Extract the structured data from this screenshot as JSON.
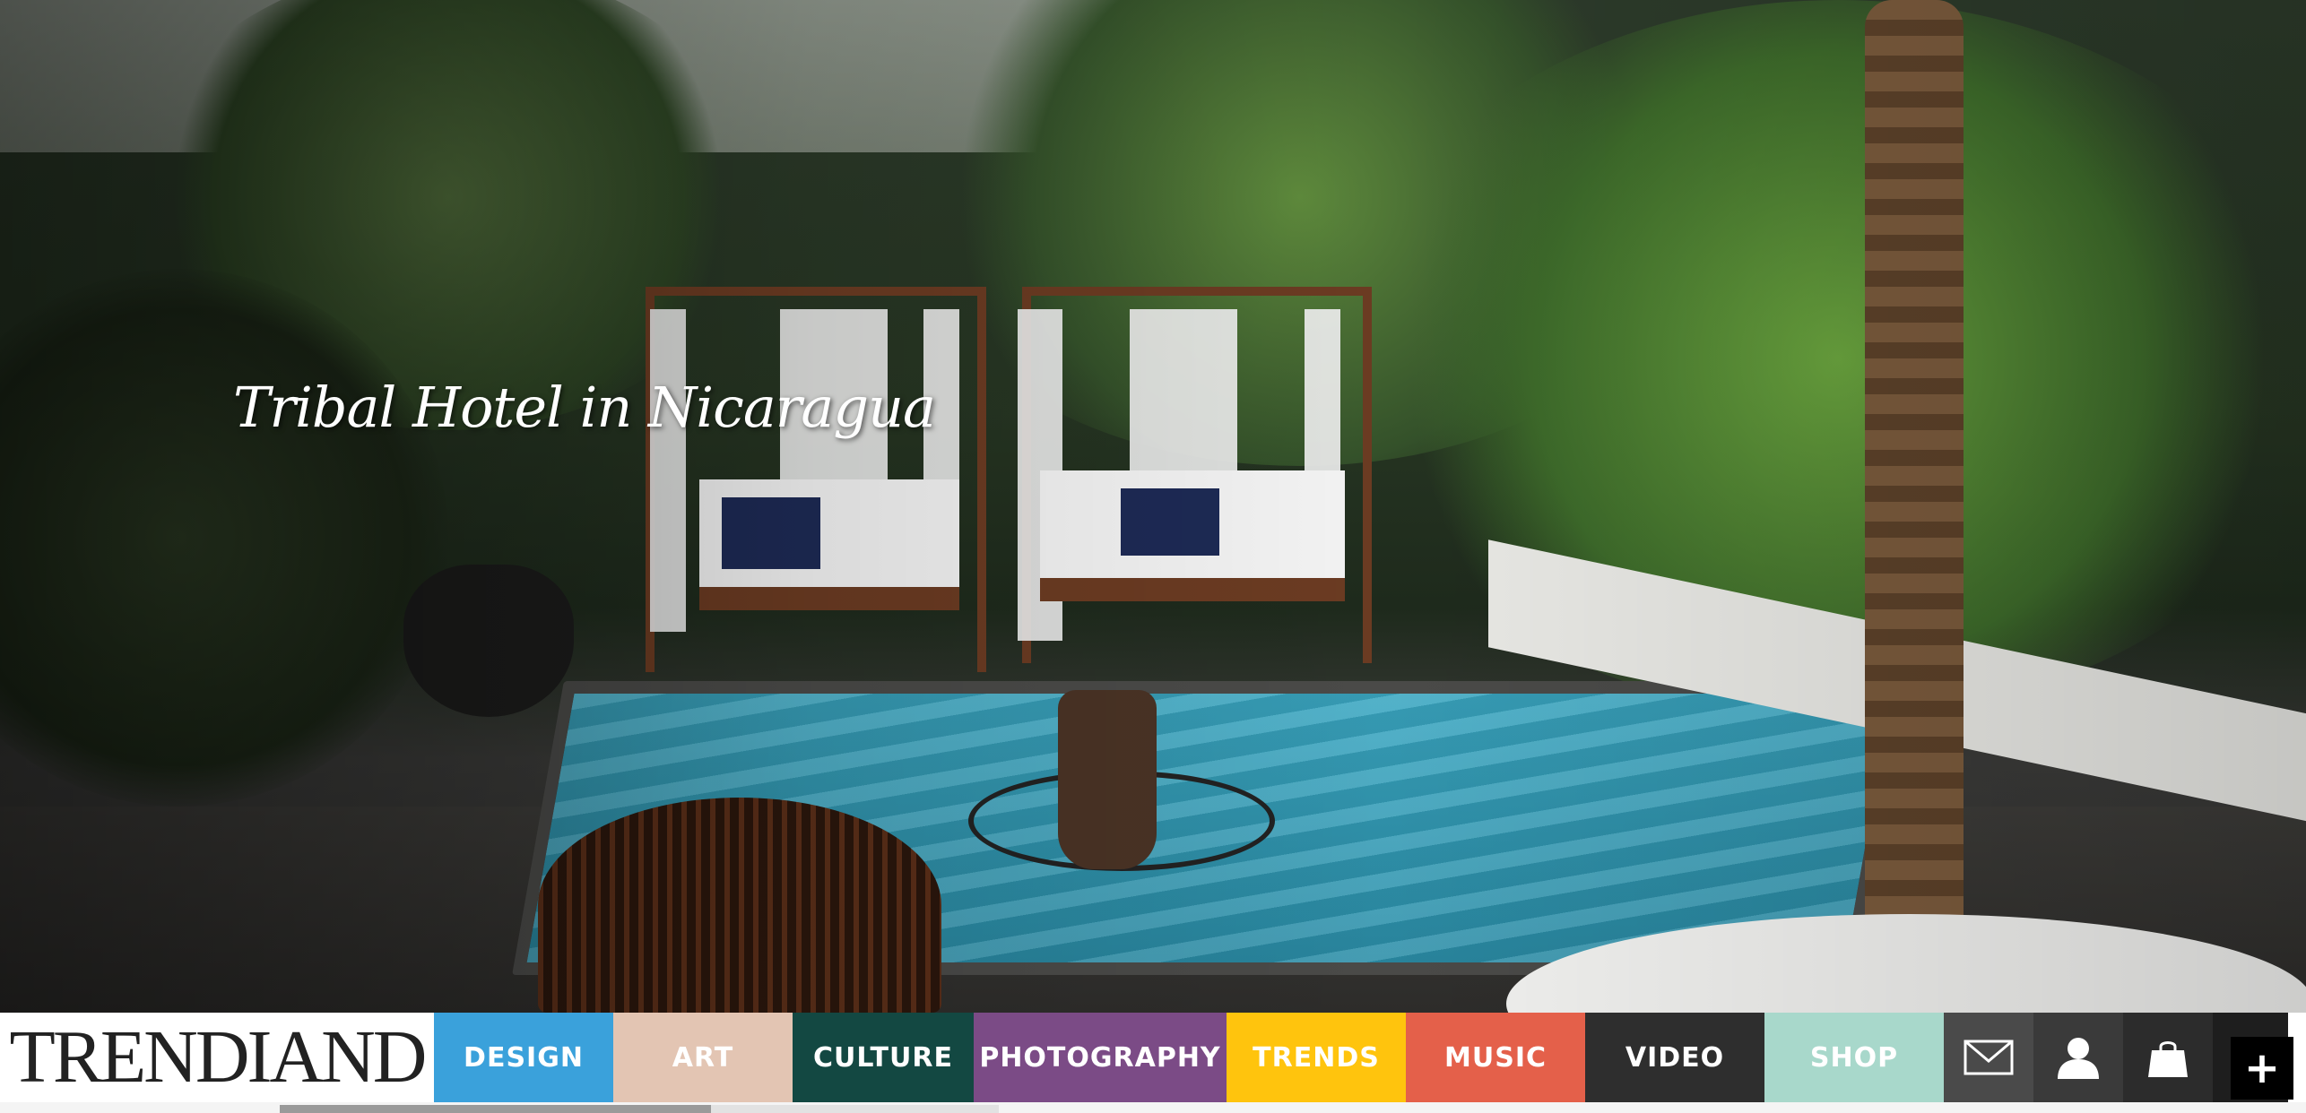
{
  "hero": {
    "title": "Tribal Hotel in Nicaragua"
  },
  "logo": {
    "text": "TRENDIAND"
  },
  "nav": {
    "items": [
      {
        "label": "DESIGN",
        "color": "#3aa1db"
      },
      {
        "label": "ART",
        "color": "#e3c5b3"
      },
      {
        "label": "CULTURE",
        "color": "#134842"
      },
      {
        "label": "PHOTOGRAPHY",
        "color": "#7b4b86"
      },
      {
        "label": "TRENDS",
        "color": "#ffc40d"
      },
      {
        "label": "MUSIC",
        "color": "#e4604a"
      },
      {
        "label": "VIDEO",
        "color": "#2e2e2e"
      },
      {
        "label": "SHOP",
        "color": "#a8d8cb"
      }
    ],
    "icons": [
      {
        "name": "mail-icon",
        "color": "#4a4a4a"
      },
      {
        "name": "user-icon",
        "color": "#3a3a3a"
      },
      {
        "name": "bag-icon",
        "color": "#2c2c2c"
      }
    ],
    "plus_label": "+"
  },
  "progress": {
    "value": 0.6
  }
}
